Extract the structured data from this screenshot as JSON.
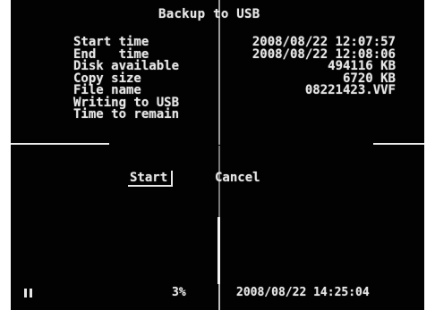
{
  "dialog": {
    "title": "Backup to USB",
    "rows": [
      {
        "label": "Start time",
        "value": "2008/08/22 12:07:57"
      },
      {
        "label": "End   time",
        "value": "2008/08/22 12:08:06"
      },
      {
        "label": "Disk available",
        "value": "494116 KB"
      },
      {
        "label": "Copy size",
        "value": "6720 KB"
      },
      {
        "label": "File name",
        "value": "08221423.VVF"
      },
      {
        "label": "Writing to USB",
        "value": ""
      },
      {
        "label": "Time to remain",
        "value": ""
      }
    ],
    "start_label": "Start",
    "cancel_label": "Cancel"
  },
  "status_bar": {
    "pause_icon": "pause-icon",
    "percent": "3%",
    "datetime": "2008/08/22 14:25:04"
  }
}
